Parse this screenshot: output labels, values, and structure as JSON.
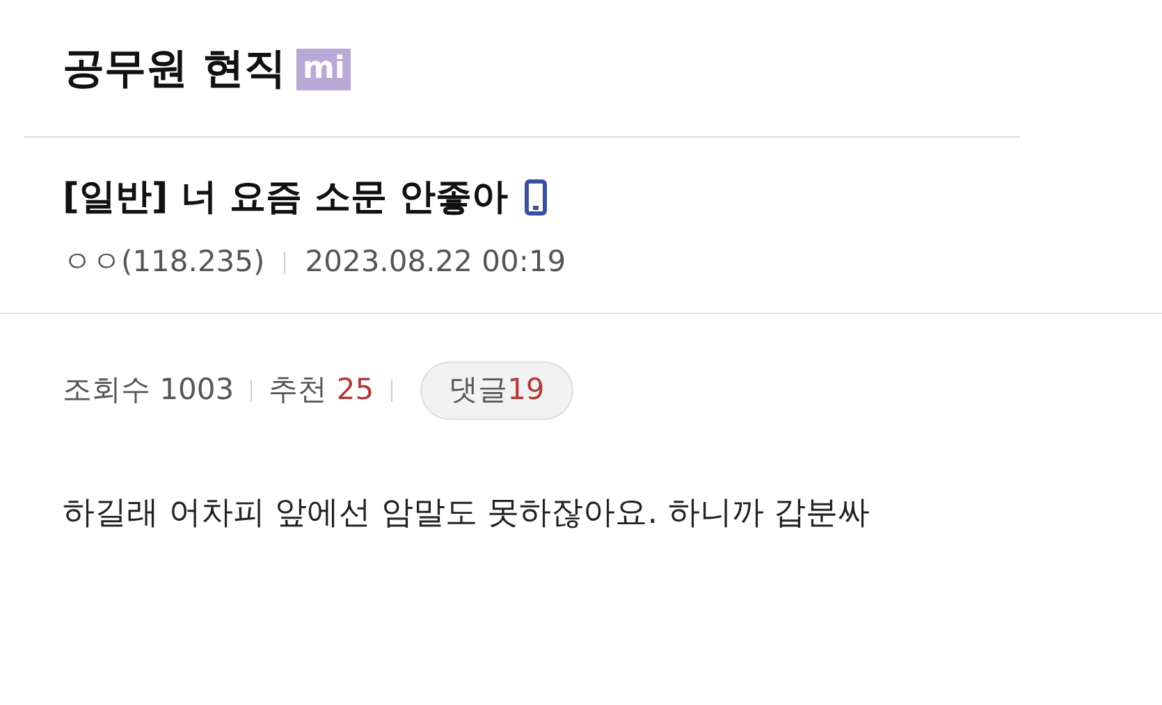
{
  "gallery": {
    "title": "공무원 현직",
    "badge": "mi"
  },
  "post": {
    "title": "[일반] 너 요즘 소문 안좋아",
    "author": "ㅇㅇ(118.235)",
    "date": "2023.08.22 00:19"
  },
  "stats": {
    "views_label": "조회수",
    "views": "1003",
    "recommend_label": "추천",
    "recommend": "25",
    "comments_label": "댓글",
    "comments": "19"
  },
  "body": "하길래 어차피 앞에선 암말도 못하잖아요. 하니까 갑분싸"
}
